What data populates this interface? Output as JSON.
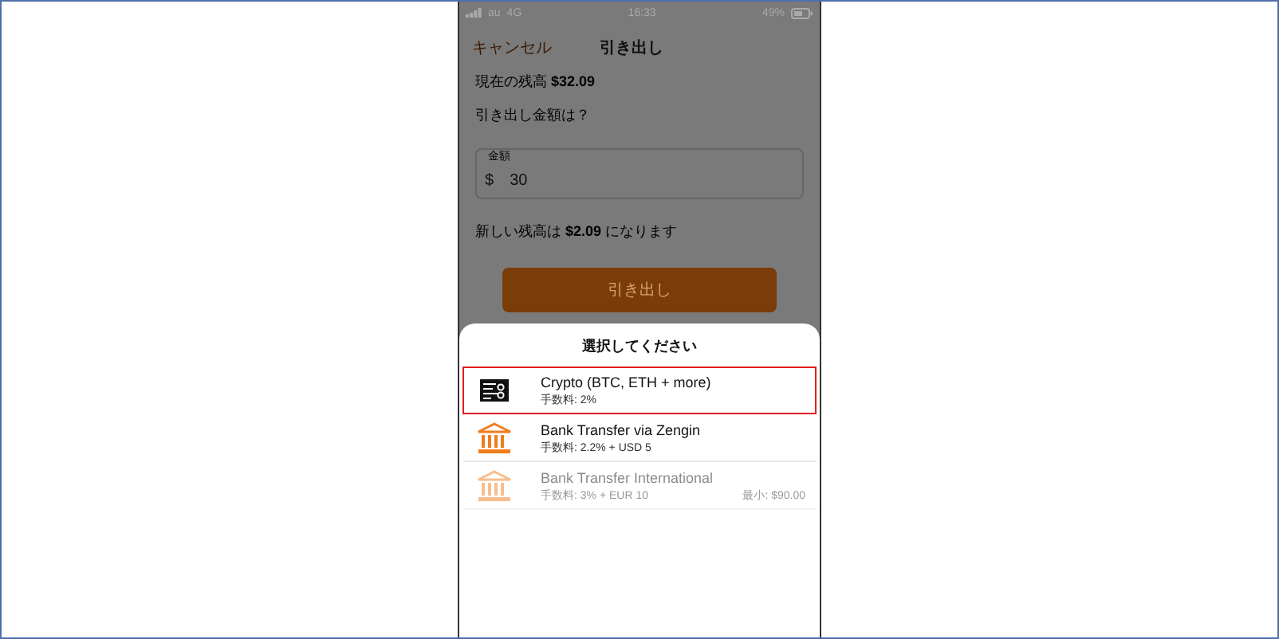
{
  "status_bar": {
    "carrier": "au",
    "network": "4G",
    "time": "16:33",
    "battery": "49%"
  },
  "nav": {
    "cancel": "キャンセル",
    "title": "引き出し"
  },
  "balance": {
    "label": "現在の残高",
    "amount": "$32.09"
  },
  "question": "引き出し金額は？",
  "amount_field": {
    "label": "金額",
    "currency": "$",
    "value": "30"
  },
  "new_balance": "新しい残高は **$2.09** になります",
  "withdraw_button": {
    "label": "引き出し",
    "disabled": true
  },
  "sheet": {
    "title": "選択してください",
    "options": [
      {
        "kind": "crypto",
        "name": "Crypto (BTC, ETH + more)",
        "fee": "手数料: 2%",
        "selected": true,
        "disabled": false
      },
      {
        "kind": "bank",
        "name": "Bank Transfer via Zengin",
        "fee": "手数料: 2.2% + USD 5",
        "selected": false,
        "disabled": false
      },
      {
        "kind": "bank",
        "name": "Bank Transfer International",
        "fee": "手数料: 3% + EUR 10",
        "minimum": "最小: $90.00",
        "selected": false,
        "disabled": true
      }
    ]
  }
}
